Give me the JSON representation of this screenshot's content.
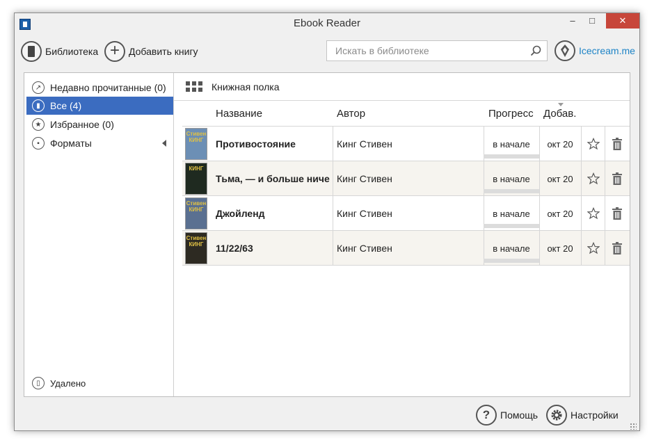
{
  "window": {
    "title": "Ebook Reader",
    "controls": {
      "minimize": "–",
      "maximize": "□",
      "close": "✕"
    }
  },
  "toolbar": {
    "library_label": "Библиотека",
    "add_book_label": "Добавить книгу",
    "search_placeholder": "Искать в библиотеке",
    "brand_label": "Icecream.me"
  },
  "sidebar": {
    "items": [
      {
        "label": "Недавно прочитанные (0)",
        "icon": "share-icon"
      },
      {
        "label": "Все (4)",
        "icon": "book-icon",
        "active": true
      },
      {
        "label": "Избранное (0)",
        "icon": "star-icon"
      },
      {
        "label": "Форматы",
        "icon": "file-icon",
        "expandable": true
      }
    ],
    "deleted_label": "Удалено"
  },
  "shelf": {
    "label": "Книжная полка"
  },
  "table": {
    "columns": {
      "title": "Название",
      "author": "Автор",
      "progress": "Прогресс",
      "added": "Добав."
    },
    "rows": [
      {
        "cover_text": "Стивен КИНГ",
        "cover_color": "#6c8fb5",
        "title": "Противостояние",
        "author": "Кинг Стивен",
        "progress_text": "в начале",
        "progress": 0,
        "added": "окт 20"
      },
      {
        "cover_text": "КИНГ",
        "cover_color": "#1f2a20",
        "title": "Тьма, — и больше ниче",
        "author": "Кинг Стивен",
        "progress_text": "в начале",
        "progress": 0,
        "added": "окт 20"
      },
      {
        "cover_text": "Стивен КИНГ",
        "cover_color": "#5a7091",
        "title": "Джойленд",
        "author": "Кинг Стивен",
        "progress_text": "в начале",
        "progress": 0,
        "added": "окт 20"
      },
      {
        "cover_text": "Стивен КИНГ",
        "cover_color": "#2d2a22",
        "title": "11/22/63",
        "author": "Кинг Стивен",
        "progress_text": "в начале",
        "progress": 0,
        "added": "окт 20"
      }
    ]
  },
  "footer": {
    "help_label": "Помощь",
    "settings_label": "Настройки"
  },
  "colors": {
    "accent": "#3b6cc0",
    "brand_link": "#1d83c6",
    "close_button": "#c7463a",
    "alt_row": "#f6f4ef"
  }
}
